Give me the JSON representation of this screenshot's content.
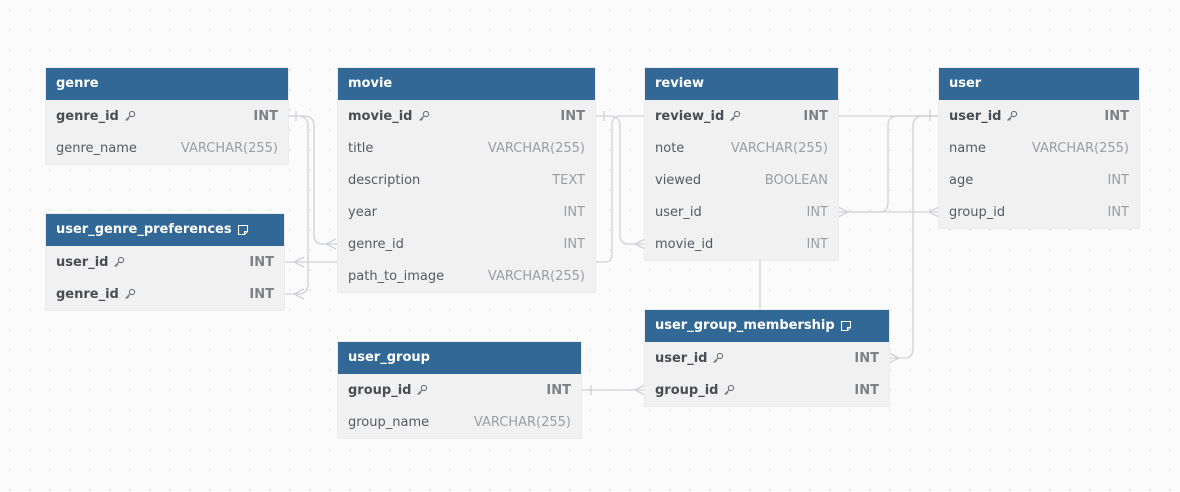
{
  "tables": [
    {
      "id": "genre",
      "title": "genre",
      "has_note": false,
      "fields": [
        {
          "name": "genre_id",
          "type": "INT",
          "pk": true
        },
        {
          "name": "genre_name",
          "type": "VARCHAR(255)",
          "pk": false
        }
      ]
    },
    {
      "id": "user_genre_preferences",
      "title": "user_genre_preferences",
      "has_note": true,
      "fields": [
        {
          "name": "user_id",
          "type": "INT",
          "pk": true
        },
        {
          "name": "genre_id",
          "type": "INT",
          "pk": true
        }
      ]
    },
    {
      "id": "movie",
      "title": "movie",
      "has_note": false,
      "fields": [
        {
          "name": "movie_id",
          "type": "INT",
          "pk": true
        },
        {
          "name": "title",
          "type": "VARCHAR(255)",
          "pk": false
        },
        {
          "name": "description",
          "type": "TEXT",
          "pk": false
        },
        {
          "name": "year",
          "type": "INT",
          "pk": false
        },
        {
          "name": "genre_id",
          "type": "INT",
          "pk": false
        },
        {
          "name": "path_to_image",
          "type": "VARCHAR(255)",
          "pk": false
        }
      ]
    },
    {
      "id": "review",
      "title": "review",
      "has_note": false,
      "fields": [
        {
          "name": "review_id",
          "type": "INT",
          "pk": true
        },
        {
          "name": "note",
          "type": "VARCHAR(255)",
          "pk": false
        },
        {
          "name": "viewed",
          "type": "BOOLEAN",
          "pk": false
        },
        {
          "name": "user_id",
          "type": "INT",
          "pk": false
        },
        {
          "name": "movie_id",
          "type": "INT",
          "pk": false
        }
      ]
    },
    {
      "id": "user",
      "title": "user",
      "has_note": false,
      "fields": [
        {
          "name": "user_id",
          "type": "INT",
          "pk": true
        },
        {
          "name": "name",
          "type": "VARCHAR(255)",
          "pk": false
        },
        {
          "name": "age",
          "type": "INT",
          "pk": false
        },
        {
          "name": "group_id",
          "type": "INT",
          "pk": false
        }
      ]
    },
    {
      "id": "user_group",
      "title": "user_group",
      "has_note": false,
      "fields": [
        {
          "name": "group_id",
          "type": "INT",
          "pk": true
        },
        {
          "name": "group_name",
          "type": "VARCHAR(255)",
          "pk": false
        }
      ]
    },
    {
      "id": "user_group_membership",
      "title": "user_group_membership",
      "has_note": true,
      "fields": [
        {
          "name": "user_id",
          "type": "INT",
          "pk": true
        },
        {
          "name": "group_id",
          "type": "INT",
          "pk": true
        }
      ]
    }
  ],
  "relations": [
    {
      "from": "user_genre_preferences.genre_id",
      "to": "genre.genre_id",
      "type": "many-to-one"
    },
    {
      "from": "movie.genre_id",
      "to": "genre.genre_id",
      "type": "many-to-one"
    },
    {
      "from": "user_genre_preferences.user_id",
      "to": "user.user_id",
      "type": "many-to-one"
    },
    {
      "from": "review.movie_id",
      "to": "movie.movie_id",
      "type": "many-to-one"
    },
    {
      "from": "review.user_id",
      "to": "user.user_id",
      "type": "many-to-one"
    },
    {
      "from": "user.group_id",
      "to": "user_group.group_id",
      "type": "many-to-one"
    },
    {
      "from": "user_group_membership.user_id",
      "to": "user.user_id",
      "type": "many-to-one"
    },
    {
      "from": "user_group_membership.group_id",
      "to": "user_group.group_id",
      "type": "many-to-one"
    }
  ],
  "colors": {
    "header": "#326896",
    "row_bg": "#f1f1f2",
    "edge": "#cfd1d4"
  },
  "icons": {
    "primary_key": "key-icon",
    "table_note": "note-icon"
  }
}
